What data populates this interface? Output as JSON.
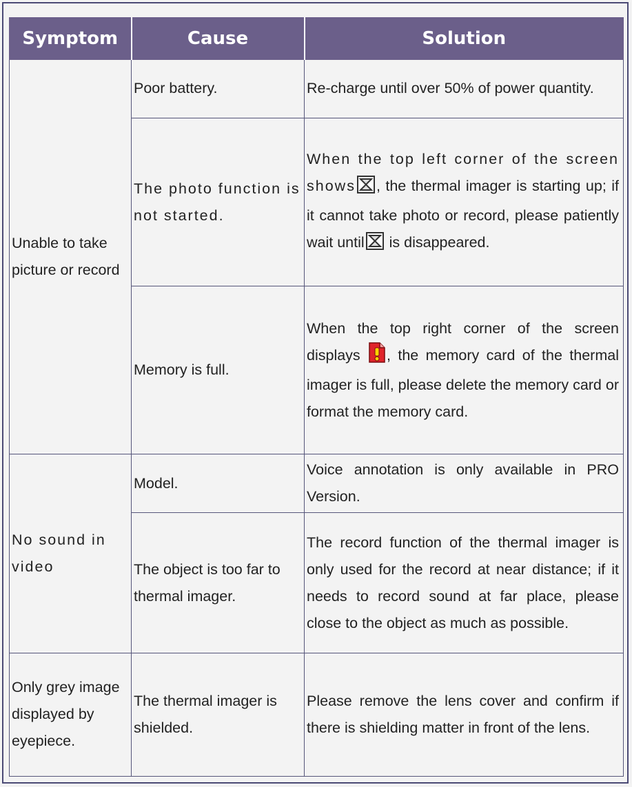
{
  "headers": {
    "symptom": "Symptom",
    "cause": "Cause",
    "solution": "Solution"
  },
  "groups": [
    {
      "symptom": "Unable to take picture or record",
      "rows": [
        {
          "cause": "Poor battery.",
          "solution": "Re-charge until over 50% of power quantity."
        },
        {
          "cause": "The photo function is not started.",
          "solution_pre": "When the top left corner of the screen shows",
          "solution_mid": ", the thermal imager is starting up; if it cannot take photo or record, please patiently wait until",
          "solution_post": "is disappeared.",
          "icon": "hourglass-icon"
        },
        {
          "cause": "Memory is full.",
          "solution_pre": "When the top right corner of the screen displays",
          "solution_post": ", the memory card of the thermal imager is full, please delete the memory card or format the memory card.",
          "icon": "memory-full-icon"
        }
      ]
    },
    {
      "symptom": "No sound in video",
      "rows": [
        {
          "cause": "Model.",
          "solution": "Voice annotation is only available in PRO Version."
        },
        {
          "cause": "The object is too far to thermal imager.",
          "solution": "The record function of the thermal imager is only used for the record at near distance; if it needs to record sound at far place, please close to the object as much as possible."
        }
      ]
    },
    {
      "symptom": "Only grey image displayed by eyepiece.",
      "rows": [
        {
          "cause": "The thermal imager is shielded.",
          "solution": "Please remove the lens cover and confirm if there is shielding matter in front of the lens."
        }
      ]
    }
  ],
  "colors": {
    "header_bg": "#6b5f8a",
    "border": "#4b4a75",
    "icon_red": "#e0242b"
  }
}
